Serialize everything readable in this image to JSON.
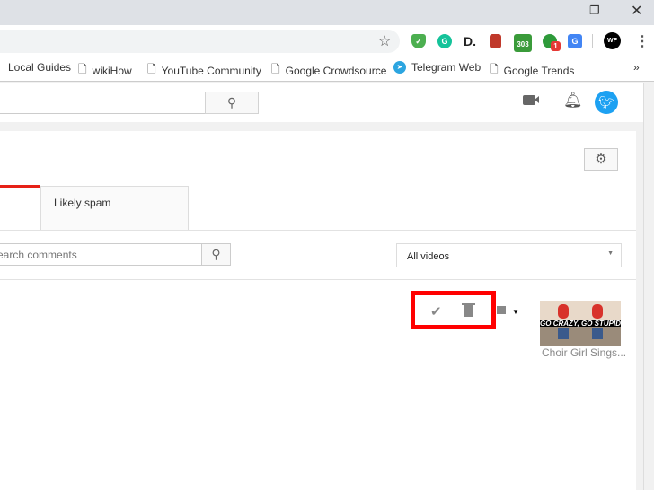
{
  "browser": {
    "bookmarks": [
      "Local Guides",
      "wikiHow",
      "YouTube Community",
      "Google Crowdsource",
      "Telegram Web",
      "Google Trends"
    ],
    "more": "»",
    "ext_badge_303": "303",
    "ext_badge_1": "1",
    "profile": "WF"
  },
  "header": {
    "search_placeholder": ""
  },
  "tabs": {
    "likely_spam": "Likely spam"
  },
  "filter": {
    "search_placeholder": "Search comments",
    "video_select": "All videos"
  },
  "comment": {
    "video_title": "Choir Girl Sings...",
    "thumb_text": "GO CRAZY, GO STUPID"
  },
  "colors": {
    "accent": "#e62117",
    "highlight": "#ff0000"
  }
}
